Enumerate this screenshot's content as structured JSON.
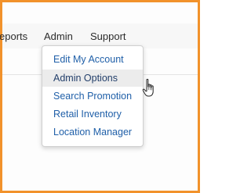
{
  "nav": {
    "items": [
      {
        "label": "eports"
      },
      {
        "label": "Admin"
      },
      {
        "label": "Support"
      }
    ]
  },
  "dropdown": {
    "items": [
      {
        "label": "Edit My Account",
        "hovered": false
      },
      {
        "label": "Admin Options",
        "hovered": true
      },
      {
        "label": "Search Promotion",
        "hovered": false
      },
      {
        "label": "Retail Inventory",
        "hovered": false
      },
      {
        "label": "Location Manager",
        "hovered": false
      }
    ]
  },
  "colors": {
    "border_accent": "#f2922b",
    "link": "#1f5fa8",
    "hover_bg": "#ececec"
  },
  "cursor": {
    "icon": "hand-pointer-icon"
  }
}
